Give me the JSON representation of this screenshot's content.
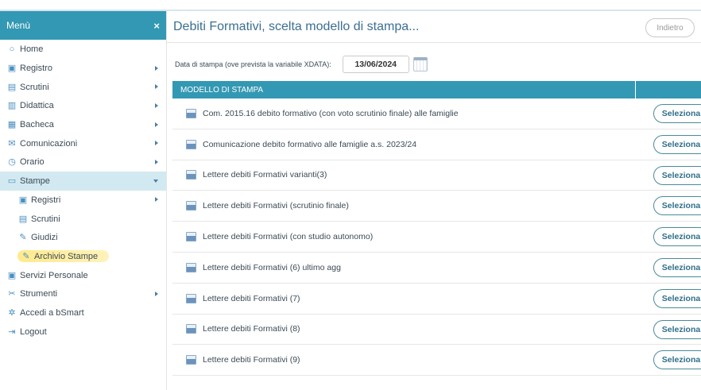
{
  "sidebar": {
    "header": "Menù",
    "close_icon": "×",
    "items": [
      {
        "label": "Home",
        "icon": "○",
        "icon_name": "home-icon",
        "submenu": false
      },
      {
        "label": "Registro",
        "icon": "▣",
        "icon_name": "calendar-icon",
        "submenu": true
      },
      {
        "label": "Scrutini",
        "icon": "▤",
        "icon_name": "document-icon",
        "submenu": true
      },
      {
        "label": "Didattica",
        "icon": "▥",
        "icon_name": "book-icon",
        "submenu": true
      },
      {
        "label": "Bacheca",
        "icon": "▦",
        "icon_name": "board-icon",
        "submenu": true
      },
      {
        "label": "Comunicazioni",
        "icon": "✉",
        "icon_name": "megaphone-icon",
        "submenu": true
      },
      {
        "label": "Orario",
        "icon": "◷",
        "icon_name": "clock-icon",
        "submenu": true
      },
      {
        "label": "Stampe",
        "icon": "▭",
        "icon_name": "print-icon",
        "submenu": true,
        "expanded": true
      },
      {
        "label": "Registri",
        "icon": "▣",
        "icon_name": "calendar-icon",
        "submenu": true
      },
      {
        "label": "Scrutini",
        "icon": "▤",
        "icon_name": "list-icon",
        "submenu": false
      },
      {
        "label": "Giudizi",
        "icon": "✎",
        "icon_name": "edit-icon",
        "submenu": false
      },
      {
        "label": "Archivio Stampe",
        "icon": "✎",
        "icon_name": "edit-icon",
        "submenu": false
      },
      {
        "label": "Servizi Personale",
        "icon": "▣",
        "icon_name": "calendar-check-icon",
        "submenu": false
      },
      {
        "label": "Strumenti",
        "icon": "✂",
        "icon_name": "tools-icon",
        "submenu": true
      },
      {
        "label": "Accedi a bSmart",
        "icon": "✲",
        "icon_name": "link-icon",
        "submenu": false
      },
      {
        "label": "Logout",
        "icon": "⇥",
        "icon_name": "logout-icon",
        "submenu": false
      }
    ]
  },
  "header": {
    "title": "Debiti Formativi, scelta modello di stampa...",
    "back_label": "Indietro"
  },
  "date": {
    "label": "Data di stampa (ove prevista la variabile XDATA):",
    "value": "13/06/2024"
  },
  "table": {
    "column_header": "MODELLO DI STAMPA",
    "select_label": "Seleziona",
    "rows": [
      "Com. 2015.16 debito formativo (con voto scrutinio finale) alle famiglie",
      "Comunicazione debito formativo alle famiglie a.s. 2023/24",
      "Lettere debiti Formativi varianti(3)",
      "Lettere debiti Formativi (scrutinio finale)",
      "Lettere debiti Formativi (con studio autonomo)",
      "Lettere debiti Formativi (6) ultimo agg",
      "Lettere debiti Formativi (7)",
      "Lettere debiti Formativi (8)",
      "Lettere debiti Formativi (9)"
    ]
  },
  "colors": {
    "accent": "#3398b3",
    "active_bg": "#d2e9f1",
    "title": "#3a6f93",
    "highlight": "#ffe678"
  }
}
